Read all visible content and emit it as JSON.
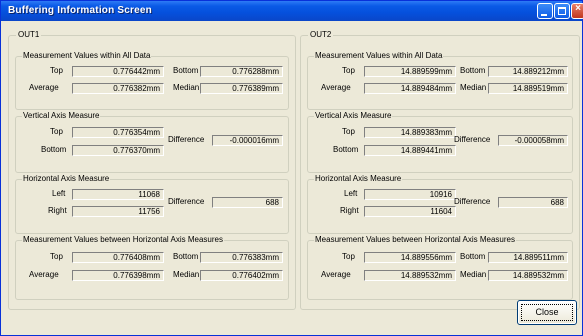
{
  "window": {
    "title": "Buffering Information Screen",
    "close_label": "Close",
    "colors": {
      "titlebar": "#0a5ae6",
      "body": "#ece9d8",
      "close_box": "#c2351c"
    }
  },
  "panels": [
    {
      "label": "OUT1",
      "all_data": {
        "title": "Measurement Values within All Data",
        "top_label": "Top",
        "top": "0.776442mm",
        "bottom_label": "Bottom",
        "bottom": "0.776288mm",
        "average_label": "Average",
        "average": "0.776382mm",
        "median_label": "Median",
        "median": "0.776389mm"
      },
      "vertical": {
        "title": "Vertical Axis Measure",
        "top_label": "Top",
        "top": "0.776354mm",
        "bottom_label": "Bottom",
        "bottom": "0.776370mm",
        "difference_label": "Difference",
        "difference": "-0.000016mm"
      },
      "horizontal": {
        "title": "Horizontal Axis Measure",
        "left_label": "Left",
        "left": "11068",
        "right_label": "Right",
        "right": "11756",
        "difference_label": "Difference",
        "difference": "688"
      },
      "between": {
        "title": "Measurement Values between Horizontal Axis Measures",
        "top_label": "Top",
        "top": "0.776408mm",
        "bottom_label": "Bottom",
        "bottom": "0.776383mm",
        "average_label": "Average",
        "average": "0.776398mm",
        "median_label": "Median",
        "median": "0.776402mm"
      }
    },
    {
      "label": "OUT2",
      "all_data": {
        "title": "Measurement Values within All Data",
        "top_label": "Top",
        "top": "14.889599mm",
        "bottom_label": "Bottom",
        "bottom": "14.889212mm",
        "average_label": "Average",
        "average": "14.889484mm",
        "median_label": "Median",
        "median": "14.889519mm"
      },
      "vertical": {
        "title": "Vertical Axis Measure",
        "top_label": "Top",
        "top": "14.889383mm",
        "bottom_label": "Bottom",
        "bottom": "14.889441mm",
        "difference_label": "Difference",
        "difference": "-0.000058mm"
      },
      "horizontal": {
        "title": "Horizontal Axis Measure",
        "left_label": "Left",
        "left": "10916",
        "right_label": "Right",
        "right": "11604",
        "difference_label": "Difference",
        "difference": "688"
      },
      "between": {
        "title": "Measurement Values between Horizontal Axis Measures",
        "top_label": "Top",
        "top": "14.889556mm",
        "bottom_label": "Bottom",
        "bottom": "14.889511mm",
        "average_label": "Average",
        "average": "14.889532mm",
        "median_label": "Median",
        "median": "14.889532mm"
      }
    }
  ]
}
